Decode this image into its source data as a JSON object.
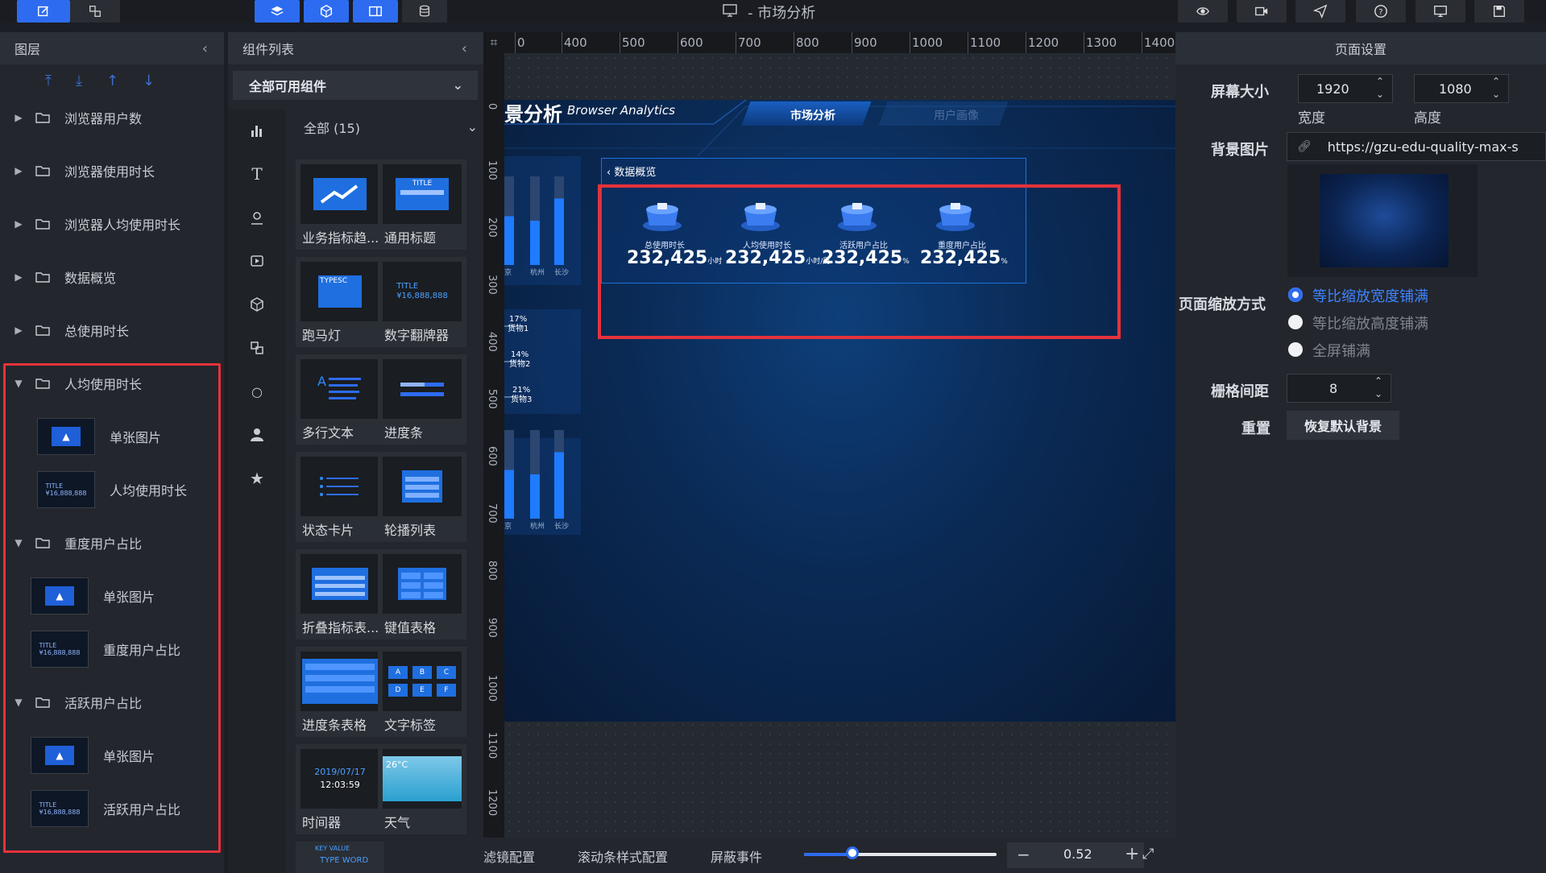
{
  "window": {
    "title": "- 市场分析"
  },
  "layer_panel": {
    "title": "图层",
    "rows": [
      {
        "label": "浏览器用户数"
      },
      {
        "label": "浏览器使用时长"
      },
      {
        "label": "浏览器人均使用时长"
      },
      {
        "label": "数据概览"
      },
      {
        "label": "总使用时长"
      },
      {
        "label": "人均使用时长"
      },
      {
        "label": "单张图片"
      },
      {
        "label": "人均使用时长"
      },
      {
        "label": "重度用户占比"
      },
      {
        "label": "单张图片"
      },
      {
        "label": "重度用户占比"
      },
      {
        "label": "活跃用户占比"
      },
      {
        "label": "单张图片"
      },
      {
        "label": "活跃用户占比"
      }
    ],
    "thumb_title_text": "TITLE",
    "thumb_value_text": "¥16,888,888"
  },
  "component_panel": {
    "title": "组件列表",
    "select": "全部可用组件",
    "all_label": "全部 (15)",
    "cards": [
      {
        "label": "业务指标趋..."
      },
      {
        "label": "通用标题"
      },
      {
        "label": "跑马灯"
      },
      {
        "label": "数字翻牌器"
      },
      {
        "label": "多行文本"
      },
      {
        "label": "进度条"
      },
      {
        "label": "状态卡片"
      },
      {
        "label": "轮播列表"
      },
      {
        "label": "折叠指标表..."
      },
      {
        "label": "键值表格"
      },
      {
        "label": "进度条表格"
      },
      {
        "label": "文字标签"
      },
      {
        "label": "时间器"
      },
      {
        "label": "天气"
      }
    ],
    "card_texts": {
      "title": "TITLE",
      "typesc": "TYPESC",
      "money": "¥16,888,888",
      "date": "2019/07/17",
      "time": "12:03:59",
      "temp": "26°C",
      "tags": [
        "A",
        "B",
        "C",
        "D",
        "E",
        "F"
      ],
      "keyvalue": "KEY VALUE",
      "typeword": "TYPE WORD"
    }
  },
  "ruler": {
    "h_ticks": [
      "0",
      "400",
      "500",
      "600",
      "700",
      "800",
      "900",
      "1000",
      "1100",
      "1200",
      "1300",
      "1400"
    ],
    "v_ticks": [
      "0",
      "100",
      "200",
      "300",
      "400",
      "500",
      "600",
      "700",
      "800",
      "900",
      "1000",
      "1100",
      "1200"
    ]
  },
  "canvas": {
    "title_fragment": "景分析",
    "subtitle": "Browser Analytics",
    "tab_active": "市场分析",
    "tab_inactive": "用户画像",
    "panel_title": "数据概览",
    "kpis": [
      {
        "label": "总使用时长",
        "value": "232,425",
        "unit": "小时"
      },
      {
        "label": "人均使用时长",
        "value": "232,425",
        "unit": "小时/周"
      },
      {
        "label": "活跃用户占比",
        "value": "232,425",
        "unit": "%"
      },
      {
        "label": "重度用户占比",
        "value": "232,425",
        "unit": "%"
      }
    ],
    "bar_labels_top": [
      "京",
      "杭州",
      "长沙"
    ],
    "bar_labels_bottom": [
      "京",
      "杭州",
      "长沙"
    ],
    "pie_items": [
      {
        "pct": "17%",
        "name": "货物1"
      },
      {
        "pct": "14%",
        "name": "货物2"
      },
      {
        "pct": "21%",
        "name": "货物3"
      }
    ]
  },
  "bottom_bar": {
    "filter": "滤镜配置",
    "scroll": "滚动条样式配置",
    "mask": "屏蔽事件",
    "zoom": "0.52",
    "minus": "−",
    "plus": "+",
    "zoom_fraction": 0.25
  },
  "settings": {
    "title": "页面设置",
    "screen_size_label": "屏幕大小",
    "width_value": "1920",
    "height_value": "1080",
    "width_label": "宽度",
    "height_label": "高度",
    "bg_image_label": "背景图片",
    "bg_url": "https://gzu-edu-quality-max-s",
    "scale_label": "页面缩放方式",
    "scale_options": [
      {
        "label": "等比缩放宽度铺满",
        "selected": true
      },
      {
        "label": "等比缩放高度铺满",
        "selected": false
      },
      {
        "label": "全屏铺满",
        "selected": false
      }
    ],
    "grid_label": "栅格间距",
    "grid_value": "8",
    "reset_label": "重置",
    "reset_button": "恢复默认背景"
  },
  "colors": {
    "accent": "#2d6cf0",
    "highlight_box": "#e5323b"
  }
}
